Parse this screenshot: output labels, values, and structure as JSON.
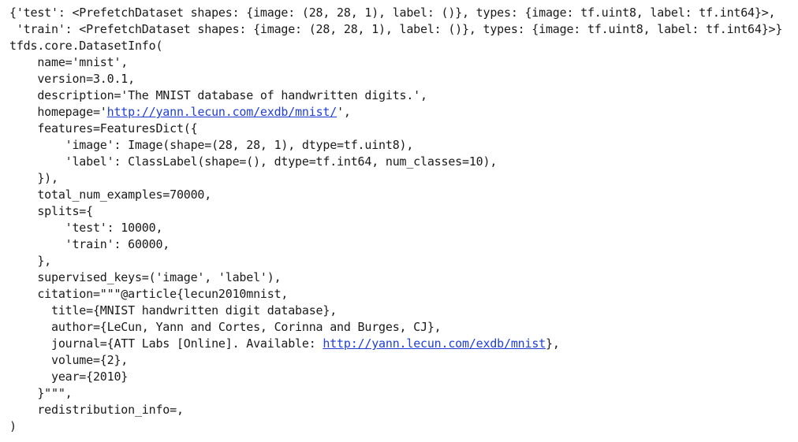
{
  "output": {
    "line_01": "{'test': <PrefetchDataset shapes: {image: (28, 28, 1), label: ()}, types: {image: tf.uint8, label: tf.int64}>,",
    "line_02": " 'train': <PrefetchDataset shapes: {image: (28, 28, 1), label: ()}, types: {image: tf.uint8, label: tf.int64}>}",
    "line_03": "tfds.core.DatasetInfo(",
    "line_04": "    name='mnist',",
    "line_05": "    version=3.0.1,",
    "line_06": "    description='The MNIST database of handwritten digits.',",
    "line_07_prefix": "    homepage='",
    "line_07_link": "http://yann.lecun.com/exdb/mnist/",
    "line_07_suffix": "',",
    "line_08": "    features=FeaturesDict({",
    "line_09": "        'image': Image(shape=(28, 28, 1), dtype=tf.uint8),",
    "line_10": "        'label': ClassLabel(shape=(), dtype=tf.int64, num_classes=10),",
    "line_11": "    }),",
    "line_12": "    total_num_examples=70000,",
    "line_13": "    splits={",
    "line_14": "        'test': 10000,",
    "line_15": "        'train': 60000,",
    "line_16": "    },",
    "line_17": "    supervised_keys=('image', 'label'),",
    "line_18": "    citation=\"\"\"@article{lecun2010mnist,",
    "line_19": "      title={MNIST handwritten digit database},",
    "line_20": "      author={LeCun, Yann and Cortes, Corinna and Burges, CJ},",
    "line_21_prefix": "      journal={ATT Labs [Online]. Available: ",
    "line_21_link": "http://yann.lecun.com/exdb/mnist",
    "line_21_suffix": "},",
    "line_22": "      volume={2},",
    "line_23": "      year={2010}",
    "line_24": "    }\"\"\",",
    "line_25": "    redistribution_info=,",
    "line_26": ")"
  }
}
